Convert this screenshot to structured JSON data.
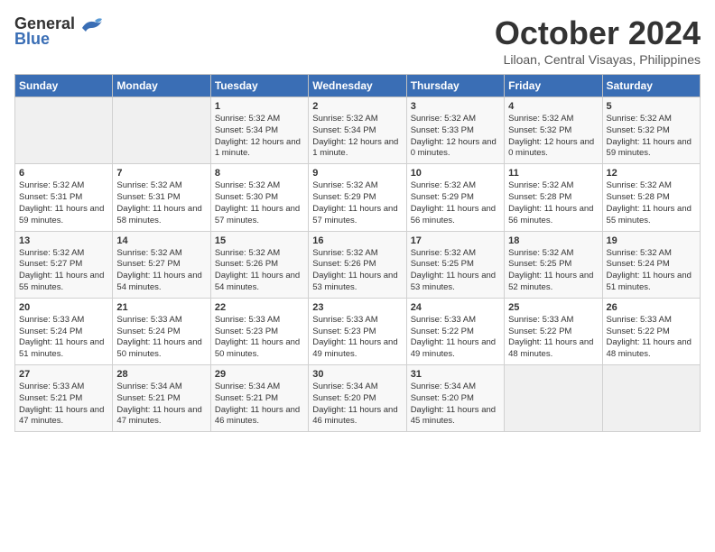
{
  "header": {
    "logo_general": "General",
    "logo_blue": "Blue",
    "month": "October 2024",
    "location": "Liloan, Central Visayas, Philippines"
  },
  "days_of_week": [
    "Sunday",
    "Monday",
    "Tuesday",
    "Wednesday",
    "Thursday",
    "Friday",
    "Saturday"
  ],
  "weeks": [
    [
      {
        "day": "",
        "info": ""
      },
      {
        "day": "",
        "info": ""
      },
      {
        "day": "1",
        "info": "Sunrise: 5:32 AM\nSunset: 5:34 PM\nDaylight: 12 hours and 1 minute."
      },
      {
        "day": "2",
        "info": "Sunrise: 5:32 AM\nSunset: 5:34 PM\nDaylight: 12 hours and 1 minute."
      },
      {
        "day": "3",
        "info": "Sunrise: 5:32 AM\nSunset: 5:33 PM\nDaylight: 12 hours and 0 minutes."
      },
      {
        "day": "4",
        "info": "Sunrise: 5:32 AM\nSunset: 5:32 PM\nDaylight: 12 hours and 0 minutes."
      },
      {
        "day": "5",
        "info": "Sunrise: 5:32 AM\nSunset: 5:32 PM\nDaylight: 11 hours and 59 minutes."
      }
    ],
    [
      {
        "day": "6",
        "info": "Sunrise: 5:32 AM\nSunset: 5:31 PM\nDaylight: 11 hours and 59 minutes."
      },
      {
        "day": "7",
        "info": "Sunrise: 5:32 AM\nSunset: 5:31 PM\nDaylight: 11 hours and 58 minutes."
      },
      {
        "day": "8",
        "info": "Sunrise: 5:32 AM\nSunset: 5:30 PM\nDaylight: 11 hours and 57 minutes."
      },
      {
        "day": "9",
        "info": "Sunrise: 5:32 AM\nSunset: 5:29 PM\nDaylight: 11 hours and 57 minutes."
      },
      {
        "day": "10",
        "info": "Sunrise: 5:32 AM\nSunset: 5:29 PM\nDaylight: 11 hours and 56 minutes."
      },
      {
        "day": "11",
        "info": "Sunrise: 5:32 AM\nSunset: 5:28 PM\nDaylight: 11 hours and 56 minutes."
      },
      {
        "day": "12",
        "info": "Sunrise: 5:32 AM\nSunset: 5:28 PM\nDaylight: 11 hours and 55 minutes."
      }
    ],
    [
      {
        "day": "13",
        "info": "Sunrise: 5:32 AM\nSunset: 5:27 PM\nDaylight: 11 hours and 55 minutes."
      },
      {
        "day": "14",
        "info": "Sunrise: 5:32 AM\nSunset: 5:27 PM\nDaylight: 11 hours and 54 minutes."
      },
      {
        "day": "15",
        "info": "Sunrise: 5:32 AM\nSunset: 5:26 PM\nDaylight: 11 hours and 54 minutes."
      },
      {
        "day": "16",
        "info": "Sunrise: 5:32 AM\nSunset: 5:26 PM\nDaylight: 11 hours and 53 minutes."
      },
      {
        "day": "17",
        "info": "Sunrise: 5:32 AM\nSunset: 5:25 PM\nDaylight: 11 hours and 53 minutes."
      },
      {
        "day": "18",
        "info": "Sunrise: 5:32 AM\nSunset: 5:25 PM\nDaylight: 11 hours and 52 minutes."
      },
      {
        "day": "19",
        "info": "Sunrise: 5:32 AM\nSunset: 5:24 PM\nDaylight: 11 hours and 51 minutes."
      }
    ],
    [
      {
        "day": "20",
        "info": "Sunrise: 5:33 AM\nSunset: 5:24 PM\nDaylight: 11 hours and 51 minutes."
      },
      {
        "day": "21",
        "info": "Sunrise: 5:33 AM\nSunset: 5:24 PM\nDaylight: 11 hours and 50 minutes."
      },
      {
        "day": "22",
        "info": "Sunrise: 5:33 AM\nSunset: 5:23 PM\nDaylight: 11 hours and 50 minutes."
      },
      {
        "day": "23",
        "info": "Sunrise: 5:33 AM\nSunset: 5:23 PM\nDaylight: 11 hours and 49 minutes."
      },
      {
        "day": "24",
        "info": "Sunrise: 5:33 AM\nSunset: 5:22 PM\nDaylight: 11 hours and 49 minutes."
      },
      {
        "day": "25",
        "info": "Sunrise: 5:33 AM\nSunset: 5:22 PM\nDaylight: 11 hours and 48 minutes."
      },
      {
        "day": "26",
        "info": "Sunrise: 5:33 AM\nSunset: 5:22 PM\nDaylight: 11 hours and 48 minutes."
      }
    ],
    [
      {
        "day": "27",
        "info": "Sunrise: 5:33 AM\nSunset: 5:21 PM\nDaylight: 11 hours and 47 minutes."
      },
      {
        "day": "28",
        "info": "Sunrise: 5:34 AM\nSunset: 5:21 PM\nDaylight: 11 hours and 47 minutes."
      },
      {
        "day": "29",
        "info": "Sunrise: 5:34 AM\nSunset: 5:21 PM\nDaylight: 11 hours and 46 minutes."
      },
      {
        "day": "30",
        "info": "Sunrise: 5:34 AM\nSunset: 5:20 PM\nDaylight: 11 hours and 46 minutes."
      },
      {
        "day": "31",
        "info": "Sunrise: 5:34 AM\nSunset: 5:20 PM\nDaylight: 11 hours and 45 minutes."
      },
      {
        "day": "",
        "info": ""
      },
      {
        "day": "",
        "info": ""
      }
    ]
  ]
}
